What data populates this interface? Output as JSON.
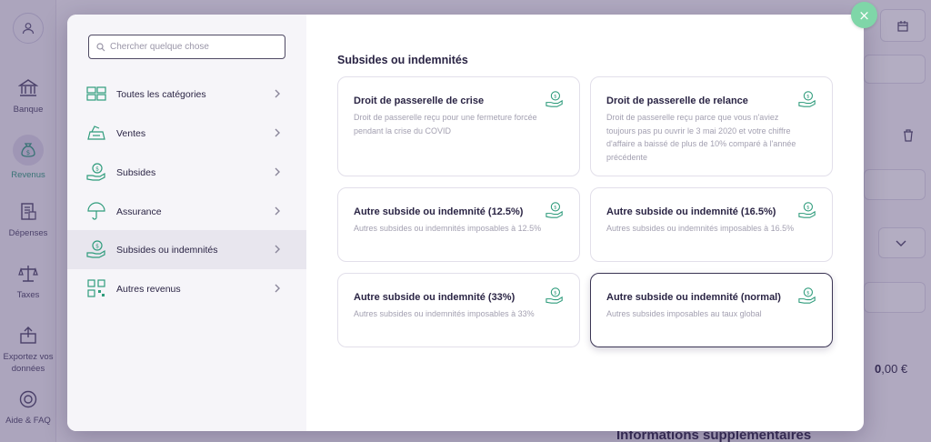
{
  "sidebar": {
    "items": [
      {
        "label": "Banque",
        "icon": "bank-icon"
      },
      {
        "label": "Revenus",
        "icon": "money-bag-icon"
      },
      {
        "label": "Dépenses",
        "icon": "receipt-icon"
      },
      {
        "label": "Taxes",
        "icon": "scale-icon"
      },
      {
        "label": "Exportez vos données",
        "icon": "export-icon"
      },
      {
        "label": "Aide & FAQ",
        "icon": "lifebuoy-icon"
      }
    ],
    "active": "Revenus"
  },
  "background": {
    "total_int": "0",
    "total_dec": ",00 €",
    "info_heading": "Informations supplémentaires"
  },
  "modal": {
    "search_placeholder": "Chercher quelque chose",
    "categories": [
      {
        "label": "Toutes les catégories",
        "icon": "grid-icon"
      },
      {
        "label": "Ventes",
        "icon": "cash-register-icon"
      },
      {
        "label": "Subsides",
        "icon": "subsidy-icon"
      },
      {
        "label": "Assurance",
        "icon": "umbrella-icon"
      },
      {
        "label": "Subsides ou indemnités",
        "icon": "subsidy-icon"
      },
      {
        "label": "Autres revenus",
        "icon": "qr-code-icon"
      }
    ],
    "selected_category": "Subsides ou indemnités",
    "section_title": "Subsides ou indemnités",
    "options": [
      {
        "title": "Droit de passerelle de crise",
        "description": "Droit de passerelle reçu pour une fermeture forcée pendant la crise du COVID"
      },
      {
        "title": "Droit de passerelle de relance",
        "description": "Droit de passerelle reçu parce que vous n'aviez toujours pas pu ouvrir le 3 mai 2020 et votre chiffre d'affaire a baissé de plus de 10% comparé à l'année précédente"
      },
      {
        "title": "Autre subside ou indemnité (12.5%)",
        "description": "Autres subsides ou indemnités imposables à 12.5%"
      },
      {
        "title": "Autre subside ou indemnité (16.5%)",
        "description": "Autres subsides ou indemnités imposables à 16.5%"
      },
      {
        "title": "Autre subside ou indemnité (33%)",
        "description": "Autres subsides ou indemnités imposables à 33%"
      },
      {
        "title": "Autre subside ou indemnité (normal)",
        "description": "Autres subsides imposables au taux global"
      }
    ],
    "selected_option": "Autre subside ou indemnité (normal)",
    "close_label": "×"
  },
  "colors": {
    "accent_green": "#2f9c7c",
    "close_button": "#7fd6a8",
    "text_dark": "#2a2444",
    "overlay": "#493c6e"
  }
}
